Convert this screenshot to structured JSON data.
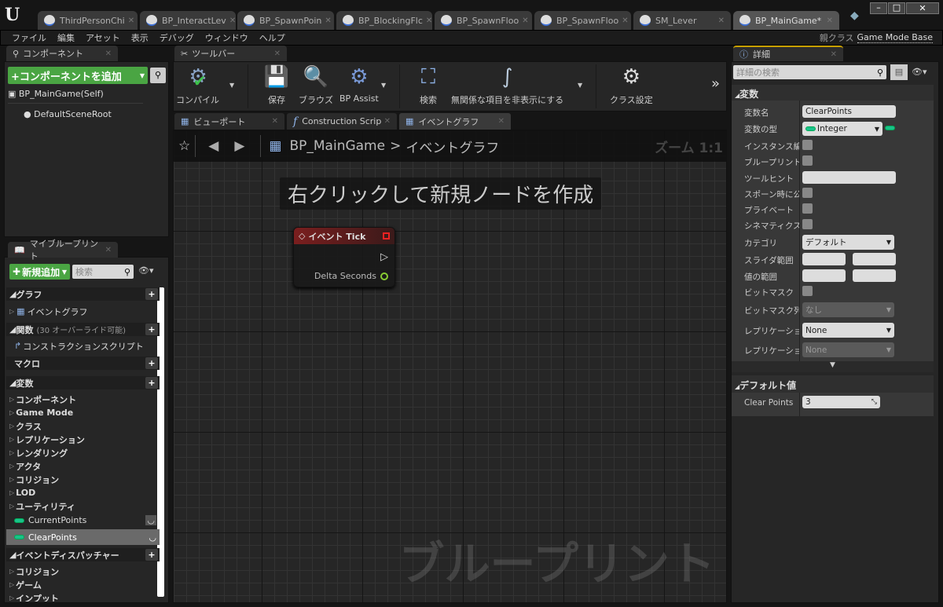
{
  "app": {
    "logo": "unreal-logo",
    "parent_class_label": "親クラス",
    "parent_class": "Game Mode Base"
  },
  "tabs": [
    {
      "label": "ThirdPersonChi",
      "icon": "character-icon"
    },
    {
      "label": "BP_InteractLev",
      "icon": "blueprint-sphere-icon"
    },
    {
      "label": "BP_SpawnPoin",
      "icon": "blueprint-sphere-icon"
    },
    {
      "label": "BP_BlockingFlc",
      "icon": "blueprint-sphere-icon"
    },
    {
      "label": "BP_SpawnFloo",
      "icon": "blueprint-sphere-icon"
    },
    {
      "label": "BP_SpawnFloo",
      "icon": "blueprint-sphere-icon"
    },
    {
      "label": "SM_Lever",
      "icon": "static-mesh-icon"
    },
    {
      "label": "BP_MainGame*",
      "icon": "gamemode-icon"
    }
  ],
  "menu": [
    "ファイル",
    "編集",
    "アセット",
    "表示",
    "デバッグ",
    "ウィンドウ",
    "ヘルプ"
  ],
  "components": {
    "tab": "コンポーネント",
    "add_button": "+コンポーネントを追加",
    "self": "BP_MainGame(Self)",
    "root": "DefaultSceneRoot"
  },
  "toolbar": {
    "tab": "ツールバー",
    "buttons": [
      "コンパイル",
      "保存",
      "ブラウズ",
      "BP Assist",
      "検索",
      "無関係な項目を非表示にする",
      "クラス設定"
    ]
  },
  "graph_tabs": [
    "ビューポート",
    "Construction Scrip",
    "イベントグラフ"
  ],
  "graph": {
    "breadcrumb_root": "BP_MainGame",
    "breadcrumb_sep": ">",
    "breadcrumb_current": "イベントグラフ",
    "zoom": "ズーム 1:1",
    "hint": "右クリックして新規ノードを作成",
    "watermark": "ブループリント",
    "node": {
      "title": "イベント Tick",
      "pin": "Delta Seconds"
    }
  },
  "my_blueprint": {
    "tab": "マイブループリント",
    "add_button": "新規追加",
    "search_placeholder": "検索",
    "graph_header": "グラフ",
    "event_graph": "イベントグラフ",
    "functions_header": "関数",
    "functions_note": "(30 オーバーライド可能)",
    "construction_script": "コンストラクションスクリプト",
    "macros_header": "マクロ",
    "variables_header": "変数",
    "categories": [
      "コンポーネント",
      "Game Mode",
      "クラス",
      "レプリケーション",
      "レンダリング",
      "アクタ",
      "コリジョン",
      "LOD",
      "ユーティリティ"
    ],
    "variables": [
      "CurrentPoints",
      "ClearPoints"
    ],
    "dispatchers_header": "イベントディスパッチャー",
    "dispatcher_categories": [
      "コリジョン",
      "ゲーム",
      "インプット"
    ]
  },
  "details": {
    "tab": "詳細",
    "search_placeholder": "詳細の検索",
    "section": "変数",
    "var_name_label": "変数名",
    "var_name": "ClearPoints",
    "var_type_label": "変数の型",
    "var_type": "Integer",
    "instance_editable": "インスタンス編集",
    "bp_readonly": "ブループリント読み取り専用",
    "tooltip": "ツールヒント",
    "expose_spawn": "スポーン時に公開",
    "private": "プライベート",
    "cinematics": "シネマティクスに公開",
    "category_label": "カテゴリ",
    "category": "デフォルト",
    "slider_range": "スライダ範囲",
    "value_range": "値の範囲",
    "bitmask": "ビットマスク",
    "bitmask_enum": "ビットマスク列挙型",
    "bitmask_enum_value": "なし",
    "replication": "レプリケーション",
    "replication_value": "None",
    "replication_cond": "レプリケーション条件",
    "replication_cond_value": "None",
    "default_section": "デフォルト値",
    "default_label": "Clear Points",
    "default_value": "3"
  },
  "colors": {
    "accent_green": "#4aa543",
    "integer_pin": "#19c28a",
    "event_node": "#7a1e1e"
  }
}
